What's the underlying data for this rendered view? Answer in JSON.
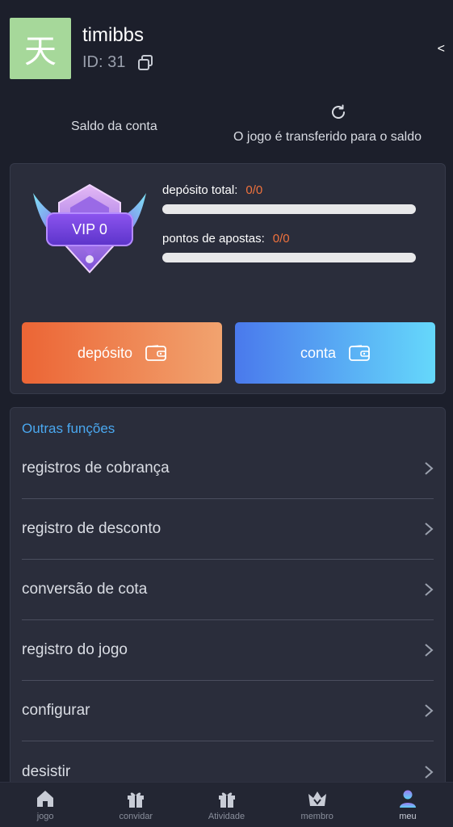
{
  "user": {
    "avatar_char": "天",
    "name": "timibbs",
    "id_label": "ID: 31"
  },
  "header": {
    "collapse_glyph": "<"
  },
  "balance": {
    "label": "Saldo da conta",
    "transfer_label": "O jogo é transferido para o saldo"
  },
  "vip": {
    "level_label": "VIP 0",
    "deposit_total_label": "depósito total:",
    "deposit_total_value": "0/0",
    "deposit_progress": 0,
    "betting_points_label": "pontos de apostas:",
    "betting_points_value": "0/0",
    "betting_progress": 0
  },
  "actions": {
    "deposit_label": "depósito",
    "account_label": "conta"
  },
  "functions": {
    "title": "Outras funções",
    "items": [
      {
        "label": "registros de cobrança"
      },
      {
        "label": "registro de desconto"
      },
      {
        "label": "conversão de cota"
      },
      {
        "label": "registro do jogo"
      },
      {
        "label": "configurar"
      },
      {
        "label": "desistir"
      }
    ]
  },
  "tabs": [
    {
      "label": "jogo",
      "icon": "home-icon"
    },
    {
      "label": "convidar",
      "icon": "gift-icon"
    },
    {
      "label": "Atividade",
      "icon": "gift-icon"
    },
    {
      "label": "membro",
      "icon": "crown-icon"
    },
    {
      "label": "meu",
      "icon": "user-icon"
    }
  ],
  "colors": {
    "accent_orange": "#f0723d",
    "accent_blue": "#4aa8f0",
    "background": "#1c1f2b",
    "card": "#2a2d3b"
  }
}
